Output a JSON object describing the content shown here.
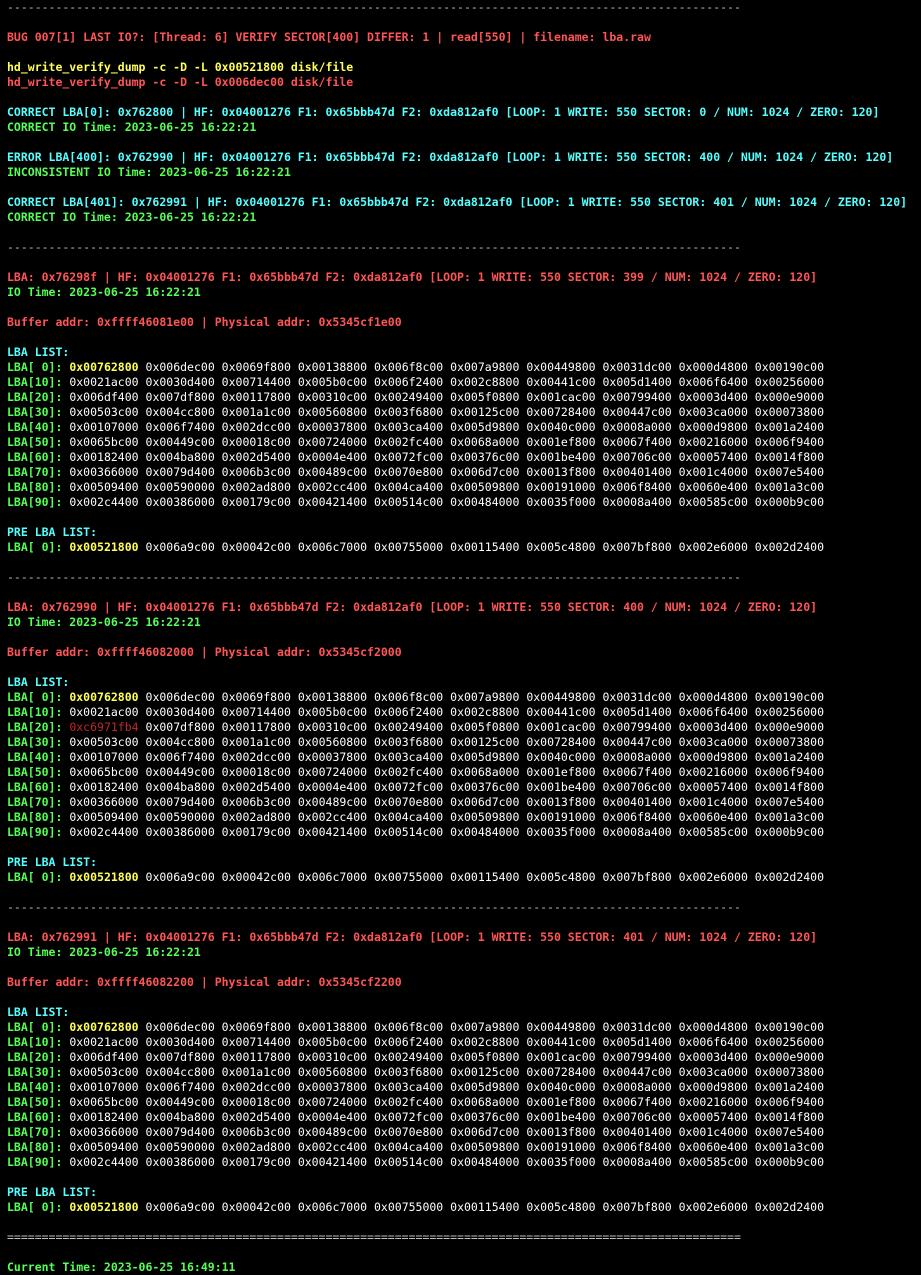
{
  "colors": {
    "background": "#000000",
    "error": "#ff5555",
    "command": "#ffff55",
    "info": "#55ffff",
    "ok": "#55ff55",
    "value": "#e6e6e6",
    "first_value": "#ffff55",
    "bad_value": "#c02a2a"
  },
  "lines": [
    {
      "type": "sep",
      "text": "----------------------------------------------------------------------------------------------------------"
    },
    {
      "type": "blank"
    },
    {
      "type": "text",
      "color": "red",
      "text": "BUG 007[1] LAST IO?: [Thread: 6] VERIFY SECTOR[400] DIFFER: 1 | read[550] | filename: lba.raw"
    },
    {
      "type": "blank"
    },
    {
      "type": "text",
      "color": "yellow",
      "text": "hd_write_verify_dump -c -D -L 0x00521800 disk/file"
    },
    {
      "type": "text",
      "color": "red",
      "text": "hd_write_verify_dump -c -D -L 0x006dec00 disk/file"
    },
    {
      "type": "blank"
    },
    {
      "type": "text",
      "color": "cyan",
      "text": "CORRECT LBA[0]: 0x762800 | HF: 0x04001276 F1: 0x65bbb47d F2: 0xda812af0 [LOOP: 1 WRITE: 550 SECTOR: 0 / NUM: 1024 / ZERO: 120]"
    },
    {
      "type": "text",
      "color": "green",
      "text": "CORRECT IO Time: 2023-06-25 16:22:21"
    },
    {
      "type": "blank"
    },
    {
      "type": "text",
      "color": "cyan",
      "text": "ERROR LBA[400]: 0x762990 | HF: 0x04001276 F1: 0x65bbb47d F2: 0xda812af0 [LOOP: 1 WRITE: 550 SECTOR: 400 / NUM: 1024 / ZERO: 120]"
    },
    {
      "type": "text",
      "color": "green",
      "text": "INCONSISTENT IO Time: 2023-06-25 16:22:21"
    },
    {
      "type": "blank"
    },
    {
      "type": "text",
      "color": "cyan",
      "text": "CORRECT LBA[401]: 0x762991 | HF: 0x04001276 F1: 0x65bbb47d F2: 0xda812af0 [LOOP: 1 WRITE: 550 SECTOR: 401 / NUM: 1024 / ZERO: 120]"
    },
    {
      "type": "text",
      "color": "green",
      "text": "CORRECT IO Time: 2023-06-25 16:22:21"
    },
    {
      "type": "blank"
    },
    {
      "type": "sep",
      "text": "----------------------------------------------------------------------------------------------------------"
    },
    {
      "type": "blank"
    },
    {
      "type": "text",
      "color": "red",
      "text": "LBA: 0x76298f | HF: 0x04001276 F1: 0x65bbb47d F2: 0xda812af0 [LOOP: 1 WRITE: 550 SECTOR: 399 / NUM: 1024 / ZERO: 120]"
    },
    {
      "type": "text",
      "color": "green",
      "text": "IO Time: 2023-06-25 16:22:21"
    },
    {
      "type": "blank"
    },
    {
      "type": "text",
      "color": "red",
      "text": "Buffer addr: 0xffff46081e00 | Physical addr: 0x5345cf1e00"
    },
    {
      "type": "blank"
    },
    {
      "type": "text",
      "color": "cyan",
      "text": "LBA LIST:"
    },
    {
      "type": "row",
      "label": "LBA[ 0]:",
      "first": "0x00762800",
      "first_style": "yellow",
      "rest": "0x006dec00 0x0069f800 0x00138800 0x006f8c00 0x007a9800 0x00449800 0x0031dc00 0x000d4800 0x00190c00"
    },
    {
      "type": "row",
      "label": "LBA[10]:",
      "first": "0x0021ac00",
      "first_style": "plain",
      "rest": "0x0030d400 0x00714400 0x005b0c00 0x006f2400 0x002c8800 0x00441c00 0x005d1400 0x006f6400 0x00256000"
    },
    {
      "type": "row",
      "label": "LBA[20]:",
      "first": "0x006df400",
      "first_style": "plain",
      "rest": "0x007df800 0x00117800 0x00310c00 0x00249400 0x005f0800 0x001cac00 0x00799400 0x0003d400 0x000e9000"
    },
    {
      "type": "row",
      "label": "LBA[30]:",
      "first": "0x00503c00",
      "first_style": "plain",
      "rest": "0x004cc800 0x001a1c00 0x00560800 0x003f6800 0x00125c00 0x00728400 0x00447c00 0x003ca000 0x00073800"
    },
    {
      "type": "row",
      "label": "LBA[40]:",
      "first": "0x00107000",
      "first_style": "plain",
      "rest": "0x006f7400 0x002dcc00 0x00037800 0x003ca400 0x005d9800 0x0040c000 0x0008a000 0x000d9800 0x001a2400"
    },
    {
      "type": "row",
      "label": "LBA[50]:",
      "first": "0x0065bc00",
      "first_style": "plain",
      "rest": "0x00449c00 0x00018c00 0x00724000 0x002fc400 0x0068a000 0x001ef800 0x0067f400 0x00216000 0x006f9400"
    },
    {
      "type": "row",
      "label": "LBA[60]:",
      "first": "0x00182400",
      "first_style": "plain",
      "rest": "0x004ba800 0x002d5400 0x0004e400 0x0072fc00 0x00376c00 0x001be400 0x00706c00 0x00057400 0x0014f800"
    },
    {
      "type": "row",
      "label": "LBA[70]:",
      "first": "0x00366000",
      "first_style": "plain",
      "rest": "0x0079d400 0x006b3c00 0x00489c00 0x0070e800 0x006d7c00 0x0013f800 0x00401400 0x001c4000 0x007e5400"
    },
    {
      "type": "row",
      "label": "LBA[80]:",
      "first": "0x00509400",
      "first_style": "plain",
      "rest": "0x00590000 0x002ad800 0x002cc400 0x004ca400 0x00509800 0x00191000 0x006f8400 0x0060e400 0x001a3c00"
    },
    {
      "type": "row",
      "label": "LBA[90]:",
      "first": "0x002c4400",
      "first_style": "plain",
      "rest": "0x00386000 0x00179c00 0x00421400 0x00514c00 0x00484000 0x0035f000 0x0008a400 0x00585c00 0x000b9c00"
    },
    {
      "type": "blank"
    },
    {
      "type": "text",
      "color": "cyan",
      "text": "PRE LBA LIST:"
    },
    {
      "type": "row",
      "label": "LBA[ 0]:",
      "first": "0x00521800",
      "first_style": "yellow",
      "rest": "0x006a9c00 0x00042c00 0x006c7000 0x00755000 0x00115400 0x005c4800 0x007bf800 0x002e6000 0x002d2400"
    },
    {
      "type": "blank"
    },
    {
      "type": "sep",
      "text": "----------------------------------------------------------------------------------------------------------"
    },
    {
      "type": "blank"
    },
    {
      "type": "text",
      "color": "red",
      "text": "LBA: 0x762990 | HF: 0x04001276 F1: 0x65bbb47d F2: 0xda812af0 [LOOP: 1 WRITE: 550 SECTOR: 400 / NUM: 1024 / ZERO: 120]"
    },
    {
      "type": "text",
      "color": "green",
      "text": "IO Time: 2023-06-25 16:22:21"
    },
    {
      "type": "blank"
    },
    {
      "type": "text",
      "color": "red",
      "text": "Buffer addr: 0xffff46082000 | Physical addr: 0x5345cf2000"
    },
    {
      "type": "blank"
    },
    {
      "type": "text",
      "color": "cyan",
      "text": "LBA LIST:"
    },
    {
      "type": "row",
      "label": "LBA[ 0]:",
      "first": "0x00762800",
      "first_style": "yellow",
      "rest": "0x006dec00 0x0069f800 0x00138800 0x006f8c00 0x007a9800 0x00449800 0x0031dc00 0x000d4800 0x00190c00"
    },
    {
      "type": "row",
      "label": "LBA[10]:",
      "first": "0x0021ac00",
      "first_style": "plain",
      "rest": "0x0030d400 0x00714400 0x005b0c00 0x006f2400 0x002c8800 0x00441c00 0x005d1400 0x006f6400 0x00256000"
    },
    {
      "type": "row",
      "label": "LBA[20]:",
      "first": "0xc6971fb4",
      "first_style": "bad",
      "rest": "0x007df800 0x00117800 0x00310c00 0x00249400 0x005f0800 0x001cac00 0x00799400 0x0003d400 0x000e9000"
    },
    {
      "type": "row",
      "label": "LBA[30]:",
      "first": "0x00503c00",
      "first_style": "plain",
      "rest": "0x004cc800 0x001a1c00 0x00560800 0x003f6800 0x00125c00 0x00728400 0x00447c00 0x003ca000 0x00073800"
    },
    {
      "type": "row",
      "label": "LBA[40]:",
      "first": "0x00107000",
      "first_style": "plain",
      "rest": "0x006f7400 0x002dcc00 0x00037800 0x003ca400 0x005d9800 0x0040c000 0x0008a000 0x000d9800 0x001a2400"
    },
    {
      "type": "row",
      "label": "LBA[50]:",
      "first": "0x0065bc00",
      "first_style": "plain",
      "rest": "0x00449c00 0x00018c00 0x00724000 0x002fc400 0x0068a000 0x001ef800 0x0067f400 0x00216000 0x006f9400"
    },
    {
      "type": "row",
      "label": "LBA[60]:",
      "first": "0x00182400",
      "first_style": "plain",
      "rest": "0x004ba800 0x002d5400 0x0004e400 0x0072fc00 0x00376c00 0x001be400 0x00706c00 0x00057400 0x0014f800"
    },
    {
      "type": "row",
      "label": "LBA[70]:",
      "first": "0x00366000",
      "first_style": "plain",
      "rest": "0x0079d400 0x006b3c00 0x00489c00 0x0070e800 0x006d7c00 0x0013f800 0x00401400 0x001c4000 0x007e5400"
    },
    {
      "type": "row",
      "label": "LBA[80]:",
      "first": "0x00509400",
      "first_style": "plain",
      "rest": "0x00590000 0x002ad800 0x002cc400 0x004ca400 0x00509800 0x00191000 0x006f8400 0x0060e400 0x001a3c00"
    },
    {
      "type": "row",
      "label": "LBA[90]:",
      "first": "0x002c4400",
      "first_style": "plain",
      "rest": "0x00386000 0x00179c00 0x00421400 0x00514c00 0x00484000 0x0035f000 0x0008a400 0x00585c00 0x000b9c00"
    },
    {
      "type": "blank"
    },
    {
      "type": "text",
      "color": "cyan",
      "text": "PRE LBA LIST:"
    },
    {
      "type": "row",
      "label": "LBA[ 0]:",
      "first": "0x00521800",
      "first_style": "yellow",
      "rest": "0x006a9c00 0x00042c00 0x006c7000 0x00755000 0x00115400 0x005c4800 0x007bf800 0x002e6000 0x002d2400"
    },
    {
      "type": "blank"
    },
    {
      "type": "sep",
      "text": "----------------------------------------------------------------------------------------------------------"
    },
    {
      "type": "blank"
    },
    {
      "type": "text",
      "color": "red",
      "text": "LBA: 0x762991 | HF: 0x04001276 F1: 0x65bbb47d F2: 0xda812af0 [LOOP: 1 WRITE: 550 SECTOR: 401 / NUM: 1024 / ZERO: 120]"
    },
    {
      "type": "text",
      "color": "green",
      "text": "IO Time: 2023-06-25 16:22:21"
    },
    {
      "type": "blank"
    },
    {
      "type": "text",
      "color": "red",
      "text": "Buffer addr: 0xffff46082200 | Physical addr: 0x5345cf2200"
    },
    {
      "type": "blank"
    },
    {
      "type": "text",
      "color": "cyan",
      "text": "LBA LIST:"
    },
    {
      "type": "row",
      "label": "LBA[ 0]:",
      "first": "0x00762800",
      "first_style": "yellow",
      "rest": "0x006dec00 0x0069f800 0x00138800 0x006f8c00 0x007a9800 0x00449800 0x0031dc00 0x000d4800 0x00190c00"
    },
    {
      "type": "row",
      "label": "LBA[10]:",
      "first": "0x0021ac00",
      "first_style": "plain",
      "rest": "0x0030d400 0x00714400 0x005b0c00 0x006f2400 0x002c8800 0x00441c00 0x005d1400 0x006f6400 0x00256000"
    },
    {
      "type": "row",
      "label": "LBA[20]:",
      "first": "0x006df400",
      "first_style": "plain",
      "rest": "0x007df800 0x00117800 0x00310c00 0x00249400 0x005f0800 0x001cac00 0x00799400 0x0003d400 0x000e9000"
    },
    {
      "type": "row",
      "label": "LBA[30]:",
      "first": "0x00503c00",
      "first_style": "plain",
      "rest": "0x004cc800 0x001a1c00 0x00560800 0x003f6800 0x00125c00 0x00728400 0x00447c00 0x003ca000 0x00073800"
    },
    {
      "type": "row",
      "label": "LBA[40]:",
      "first": "0x00107000",
      "first_style": "plain",
      "rest": "0x006f7400 0x002dcc00 0x00037800 0x003ca400 0x005d9800 0x0040c000 0x0008a000 0x000d9800 0x001a2400"
    },
    {
      "type": "row",
      "label": "LBA[50]:",
      "first": "0x0065bc00",
      "first_style": "plain",
      "rest": "0x00449c00 0x00018c00 0x00724000 0x002fc400 0x0068a000 0x001ef800 0x0067f400 0x00216000 0x006f9400"
    },
    {
      "type": "row",
      "label": "LBA[60]:",
      "first": "0x00182400",
      "first_style": "plain",
      "rest": "0x004ba800 0x002d5400 0x0004e400 0x0072fc00 0x00376c00 0x001be400 0x00706c00 0x00057400 0x0014f800"
    },
    {
      "type": "row",
      "label": "LBA[70]:",
      "first": "0x00366000",
      "first_style": "plain",
      "rest": "0x0079d400 0x006b3c00 0x00489c00 0x0070e800 0x006d7c00 0x0013f800 0x00401400 0x001c4000 0x007e5400"
    },
    {
      "type": "row",
      "label": "LBA[80]:",
      "first": "0x00509400",
      "first_style": "plain",
      "rest": "0x00590000 0x002ad800 0x002cc400 0x004ca400 0x00509800 0x00191000 0x006f8400 0x0060e400 0x001a3c00"
    },
    {
      "type": "row",
      "label": "LBA[90]:",
      "first": "0x002c4400",
      "first_style": "plain",
      "rest": "0x00386000 0x00179c00 0x00421400 0x00514c00 0x00484000 0x0035f000 0x0008a400 0x00585c00 0x000b9c00"
    },
    {
      "type": "blank"
    },
    {
      "type": "text",
      "color": "cyan",
      "text": "PRE LBA LIST:"
    },
    {
      "type": "row",
      "label": "LBA[ 0]:",
      "first": "0x00521800",
      "first_style": "yellow",
      "rest": "0x006a9c00 0x00042c00 0x006c7000 0x00755000 0x00115400 0x005c4800 0x007bf800 0x002e6000 0x002d2400"
    },
    {
      "type": "blank"
    },
    {
      "type": "sep",
      "text": "=========================================================================================================="
    },
    {
      "type": "blank"
    },
    {
      "type": "text",
      "color": "green",
      "text": "Current Time: 2023-06-25 16:49:11"
    }
  ]
}
